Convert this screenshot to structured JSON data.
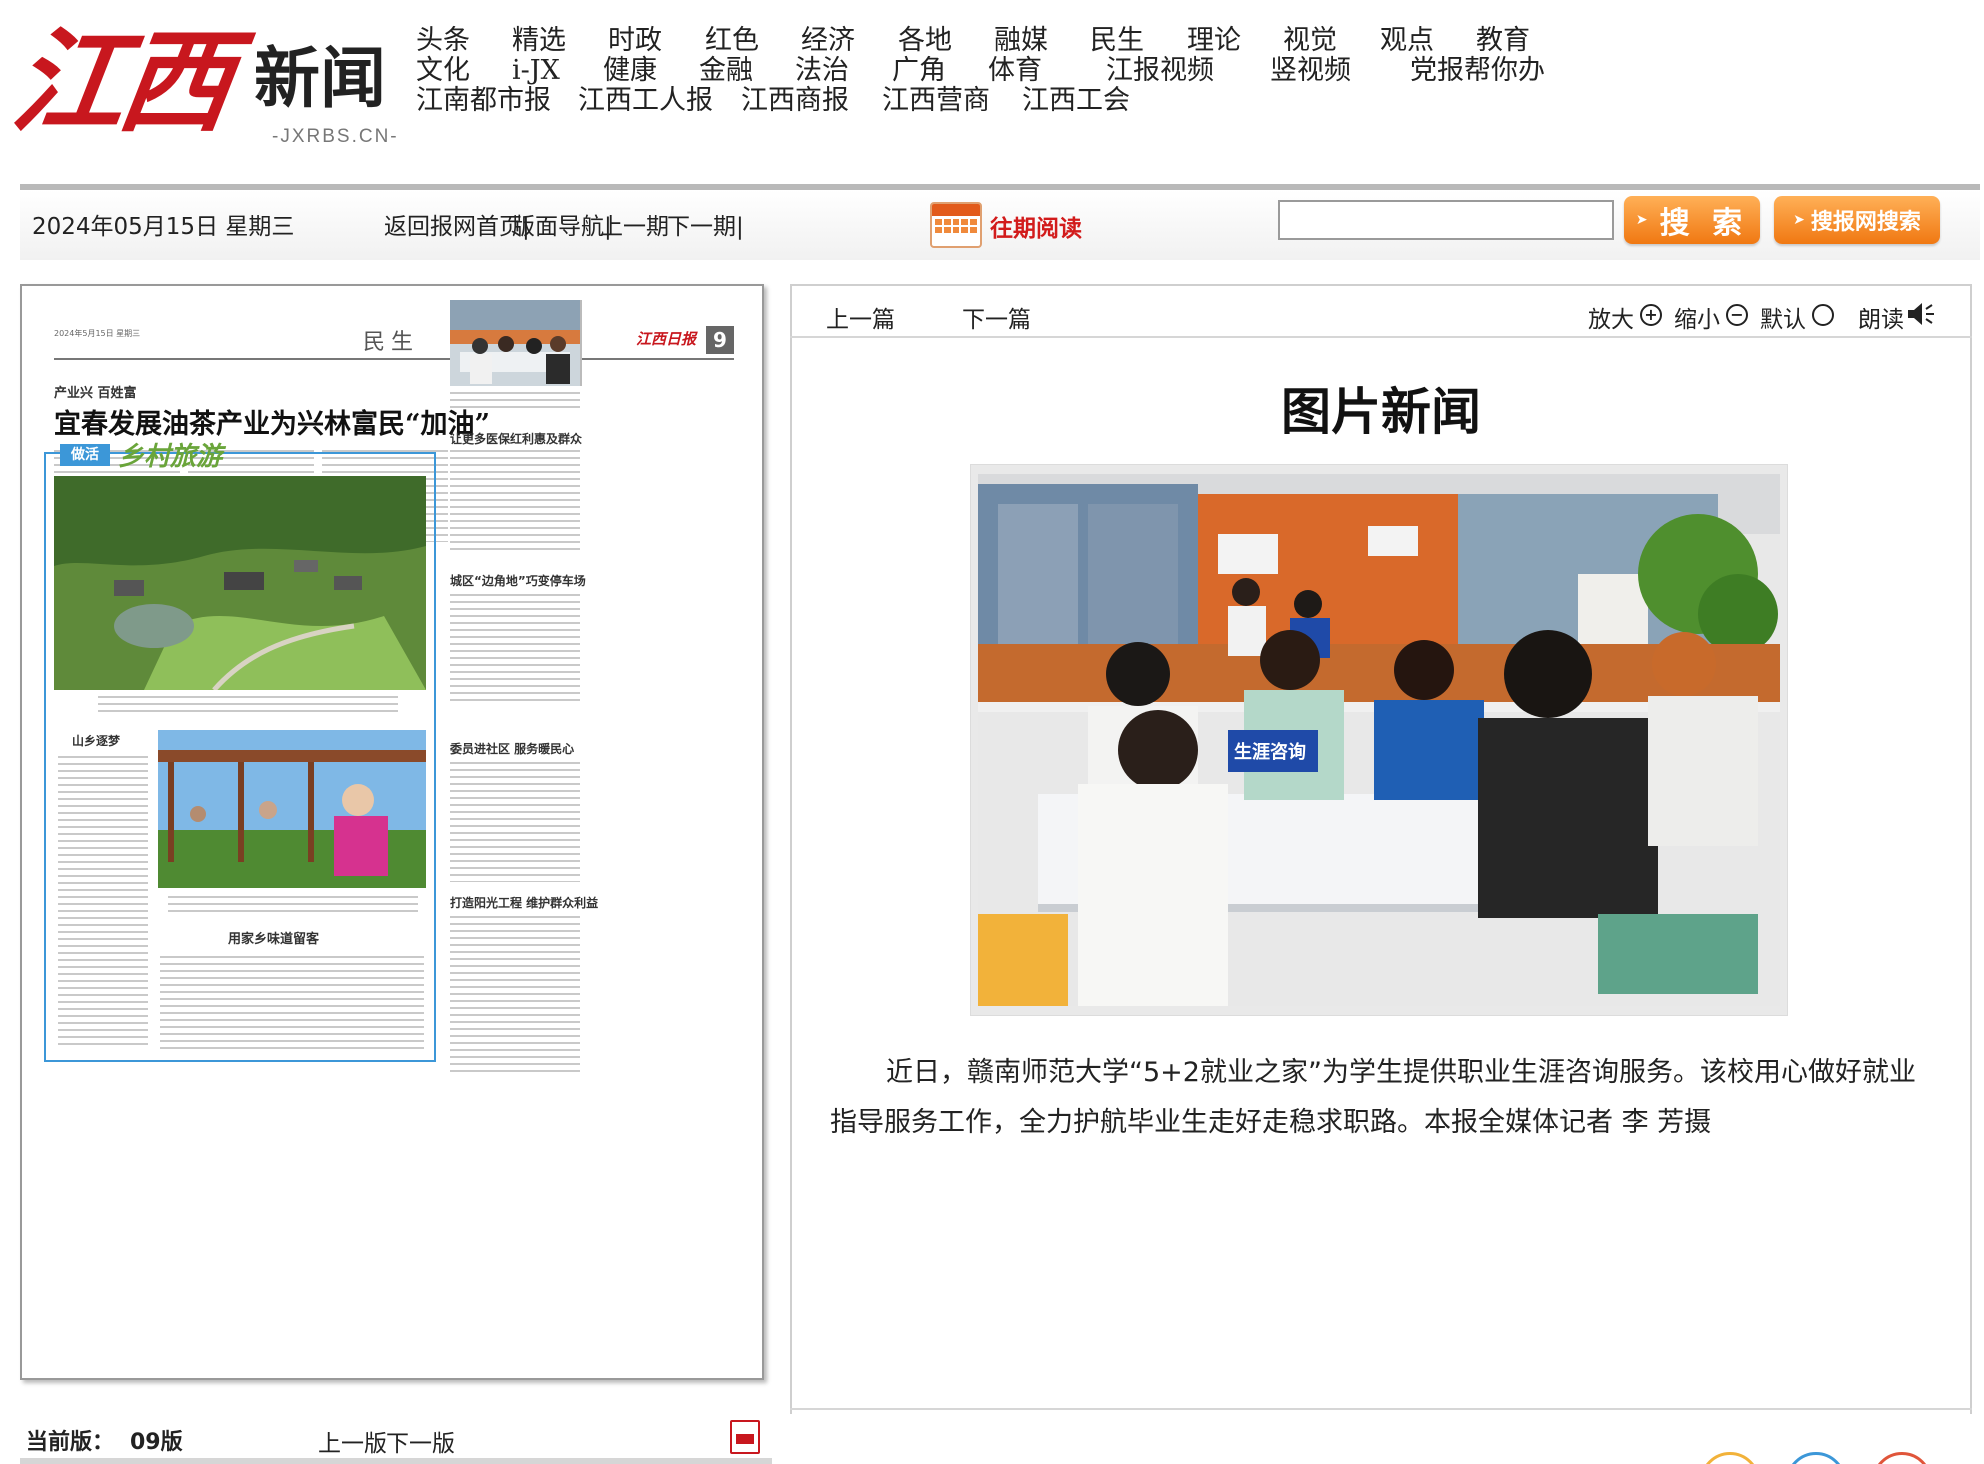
{
  "logo": {
    "mark": "江西",
    "name": "新闻",
    "domain": "-JXRBS.CN-"
  },
  "nav": {
    "row1": [
      "头条",
      "精选",
      "时政",
      "红色",
      "经济",
      "各地",
      "融媒",
      "民生",
      "理论",
      "视觉",
      "观点",
      "教育"
    ],
    "row2": [
      "文化",
      "i-JX",
      "健康",
      "金融",
      "法治",
      "广角",
      "体育",
      "江报视频",
      "竖视频",
      "党报帮你办"
    ],
    "row3": [
      "江南都市报",
      "江西工人报",
      "江西商报",
      "江西营商",
      "江西工会"
    ]
  },
  "toolbar": {
    "date": "2024年05月15日 星期三",
    "home_link": "返回报网首页|",
    "layout_nav": "版面导航|",
    "prev_issue": "上一期",
    "next_issue": "下一期|",
    "archive": "往期阅读",
    "search_placeholder": "",
    "search_button": "搜 索",
    "site_search_button": "搜报网搜索"
  },
  "newspaper": {
    "date": "2024年5月15日 星期三",
    "section": "民生",
    "masthead": "江西日报",
    "page_number": "9",
    "kicker": "产业兴 百姓富",
    "headline": "宜春发展油茶产业为兴林富民“加油”",
    "badge": "做活",
    "script_title": "乡村旅游",
    "sub1": "让更多医保红利惠及群众",
    "sub2": "城区“边角地”巧变停车场",
    "sub3": "山乡逐梦",
    "sub4": "委员进社区 服务暖民心",
    "sub5": "用家乡味道留客",
    "sub6": "打造阳光工程 维护群众利益"
  },
  "page_footer": {
    "current_label": "当前版：",
    "current_value": "09版",
    "prev_page": "上一版",
    "next_page": "下一版"
  },
  "article": {
    "prev": "上一篇",
    "next": "下一篇",
    "zoom_in": "放大",
    "zoom_out": "缩小",
    "default": "默认",
    "read_aloud": "朗读",
    "title": "图片新闻",
    "photo_sign": "生涯咨询",
    "caption": "近日，赣南师范大学“5+2就业之家”为学生提供职业生涯咨询服务。该校用心做好就业指导服务工作，全力护航毕业生走好走稳求职路。本报全媒体记者 李 芳摄"
  },
  "colors": {
    "brand_red": "#c8171e",
    "button_orange": "#f07812",
    "paper_box_blue": "#3c97d8"
  }
}
